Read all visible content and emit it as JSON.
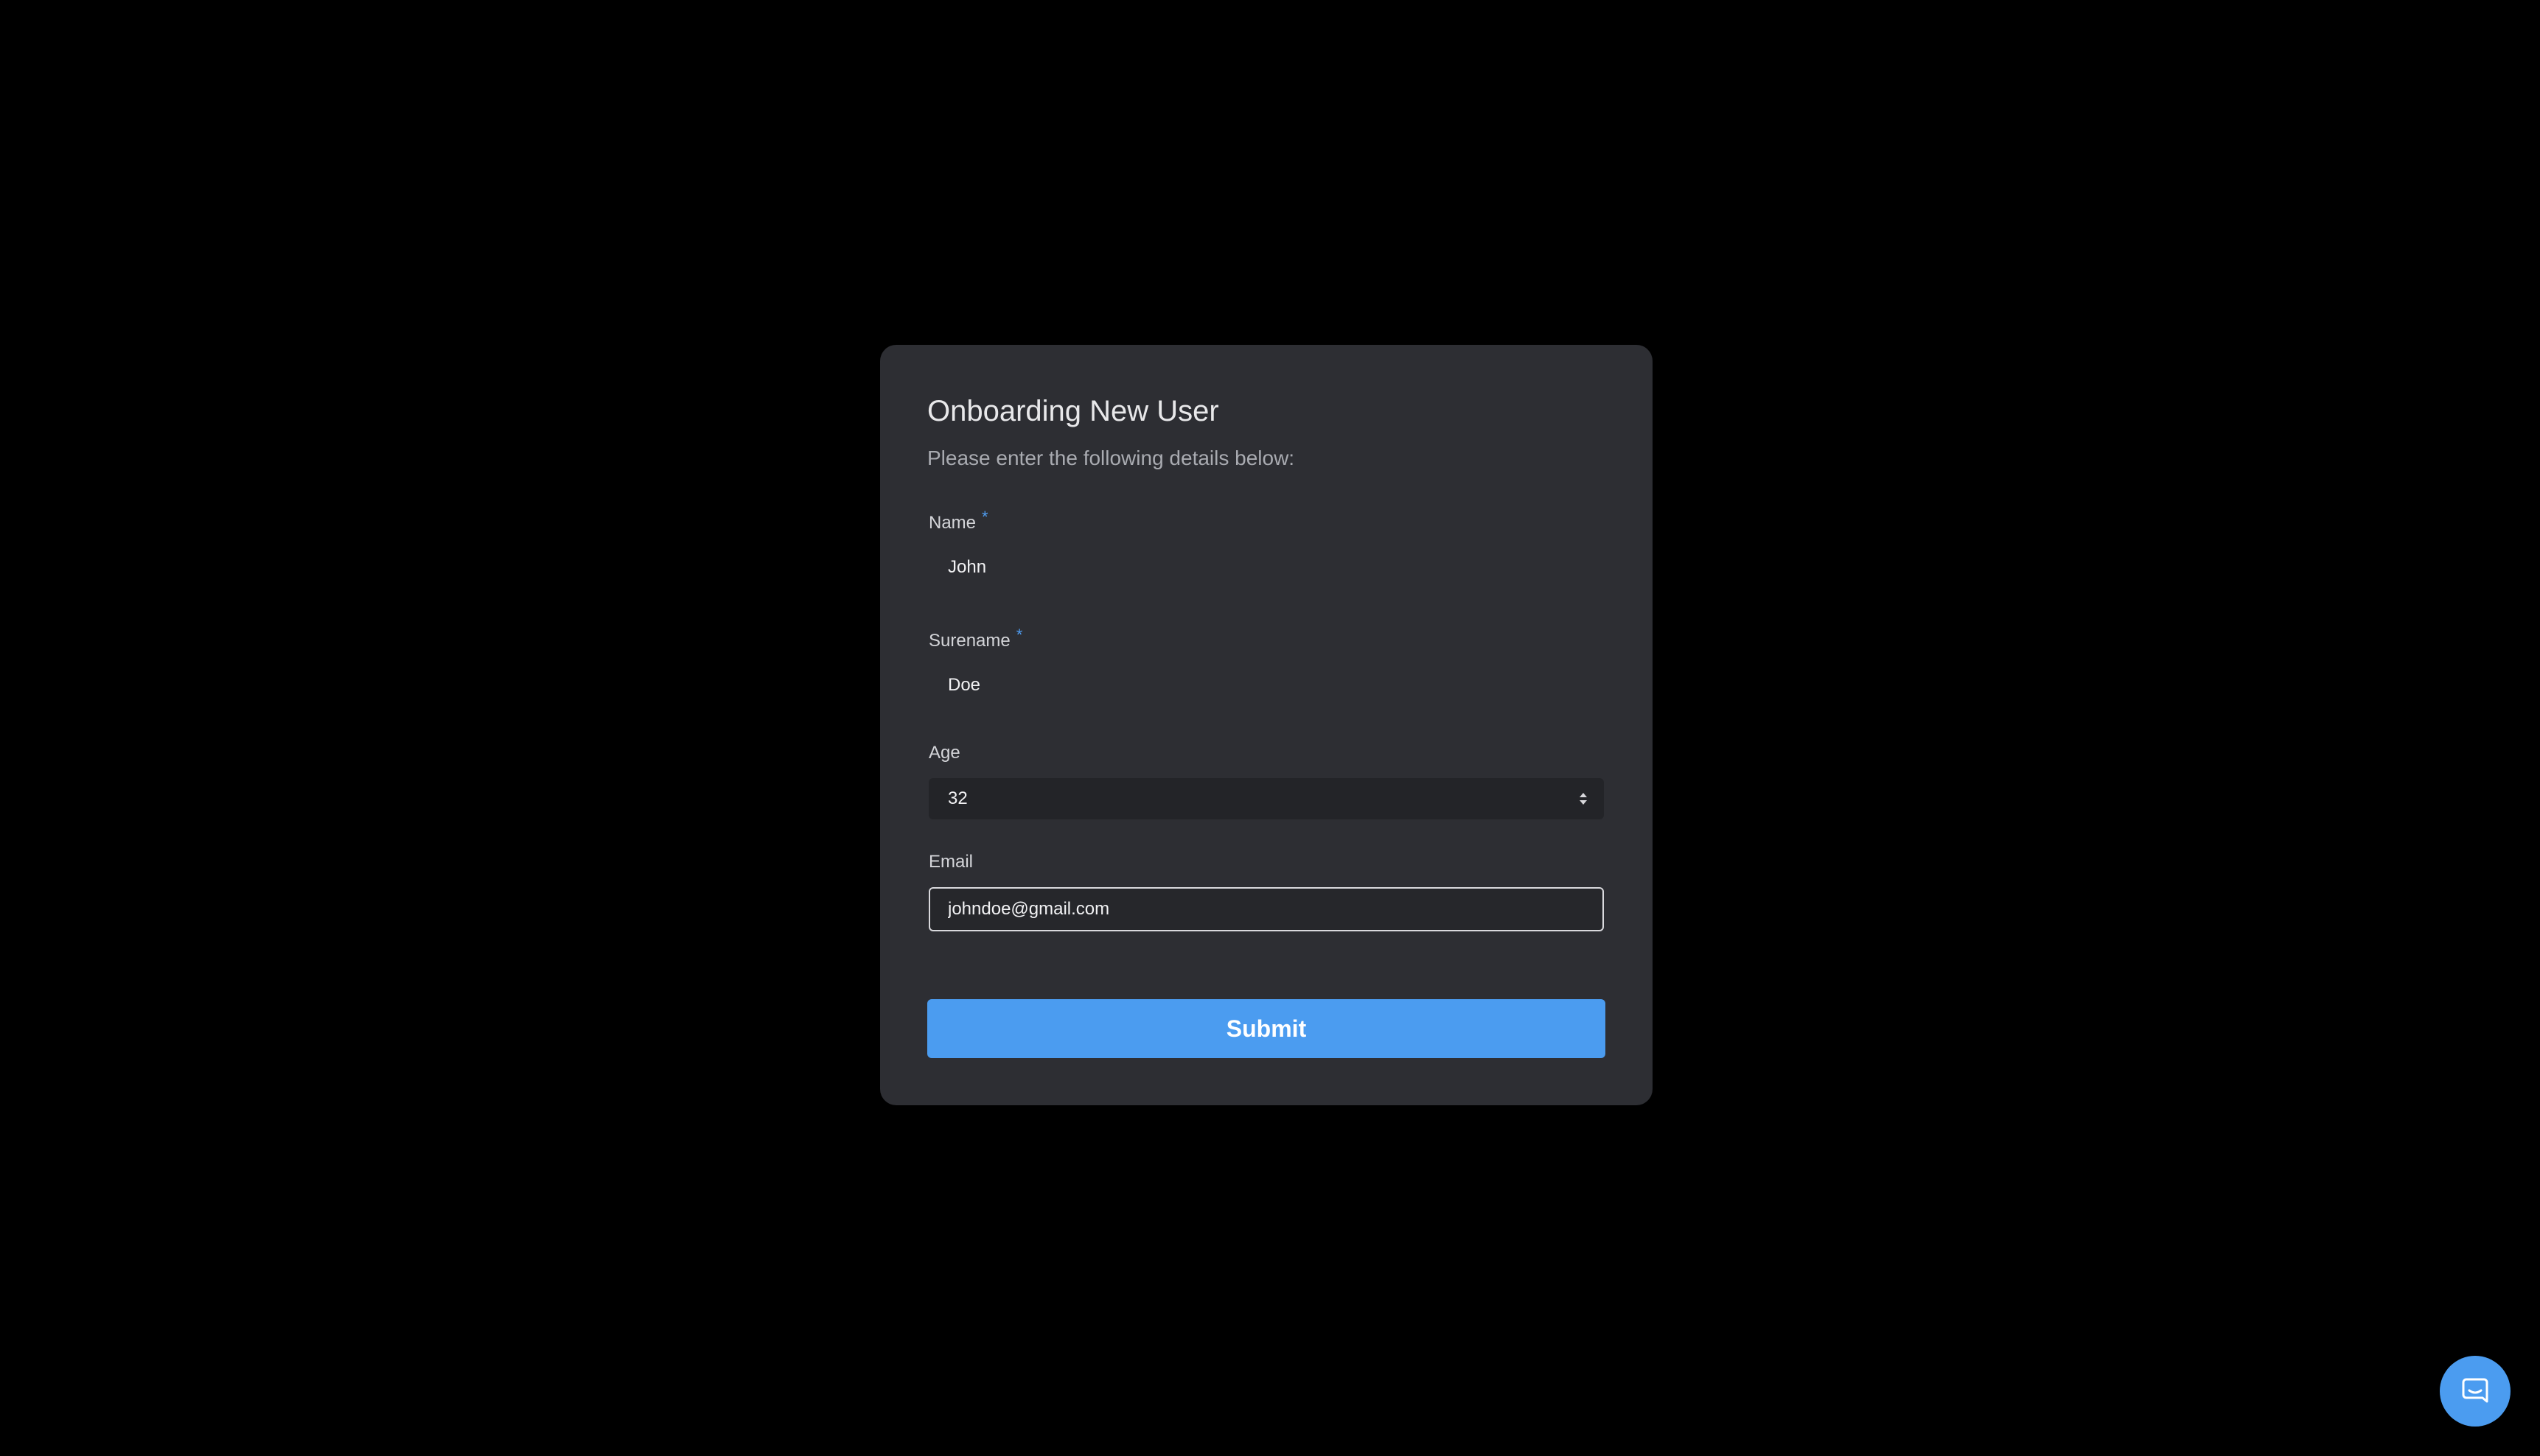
{
  "form": {
    "title": "Onboarding New User",
    "subtitle": "Please enter the following details below:",
    "required_mark": "*",
    "name": {
      "label": "Name",
      "value": "John",
      "required": true
    },
    "surname": {
      "label": "Surename",
      "value": "Doe",
      "required": true
    },
    "age": {
      "label": "Age",
      "selected": "32"
    },
    "email": {
      "label": "Email",
      "value": "johndoe@gmail.com"
    },
    "submit_label": "Submit"
  },
  "icons": {
    "select_arrow": "updown-icon",
    "chat_launcher": "chat-bubble-icon"
  },
  "colors": {
    "accent": "#4b9cf0",
    "card_bg": "#2d2e33",
    "page_bg": "#000000"
  }
}
